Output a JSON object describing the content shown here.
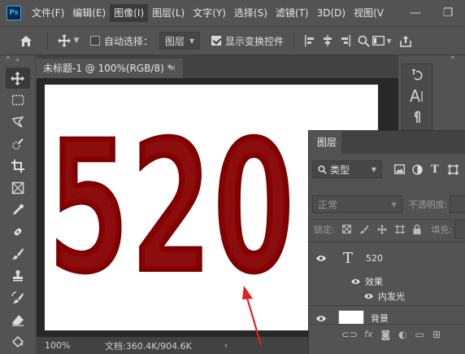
{
  "app": {
    "logo": "Ps",
    "menu": [
      "文件(F)",
      "编辑(E)",
      "图像(I)",
      "图层(L)",
      "文字(Y)",
      "选择(S)",
      "滤镜(T)",
      "3D(D)",
      "视图(V"
    ],
    "active_menu_index": 2,
    "window_buttons": {
      "minimize": "—",
      "restore": "❐"
    }
  },
  "options": {
    "home_icon": "home-icon",
    "move_icon": "move-icon",
    "auto_select_label": "自动选择：",
    "auto_select_checked": false,
    "auto_select_target": "图层",
    "show_transform_label": "显示变换控件",
    "show_transform_checked": true
  },
  "toolbar": {
    "collapse": "»",
    "tools": [
      "move-tool-icon",
      "marquee-tool-icon",
      "lasso-tool-icon",
      "quick-select-tool-icon",
      "crop-tool-icon",
      "frame-tool-icon",
      "eyedropper-tool-icon",
      "healing-brush-tool-icon",
      "brush-tool-icon",
      "stamp-tool-icon",
      "history-brush-tool-icon",
      "eraser-tool-icon",
      "paint-bucket-tool-icon"
    ]
  },
  "document": {
    "collapse_left": "»",
    "collapse_right": "«",
    "tab_title": "未标题-1 @ 100%(RGB/8) *",
    "tab_close": "×",
    "canvas_text": "520",
    "text_color": "#8b0a0a",
    "zoom": "100%",
    "doc_size": "文档:360.4K/904.6K",
    "status_arrow": "›"
  },
  "right_dock": {
    "tools": [
      "history-icon",
      "character-icon",
      "paragraph-icon"
    ]
  },
  "layers_panel": {
    "tab": "图层",
    "filter_label": "类型",
    "blend_mode": "正常",
    "opacity_label": "不透明度:",
    "lock_label": "锁定:",
    "fill_label": "填充:",
    "layers": [
      {
        "type": "text",
        "name": "520",
        "visible": true
      },
      {
        "type": "effects",
        "name": "效果",
        "visible": true
      },
      {
        "type": "effect",
        "name": "内发光",
        "visible": true
      },
      {
        "type": "pixel",
        "name": "背景",
        "visible": true
      }
    ]
  },
  "annotation_color": "#e02020"
}
